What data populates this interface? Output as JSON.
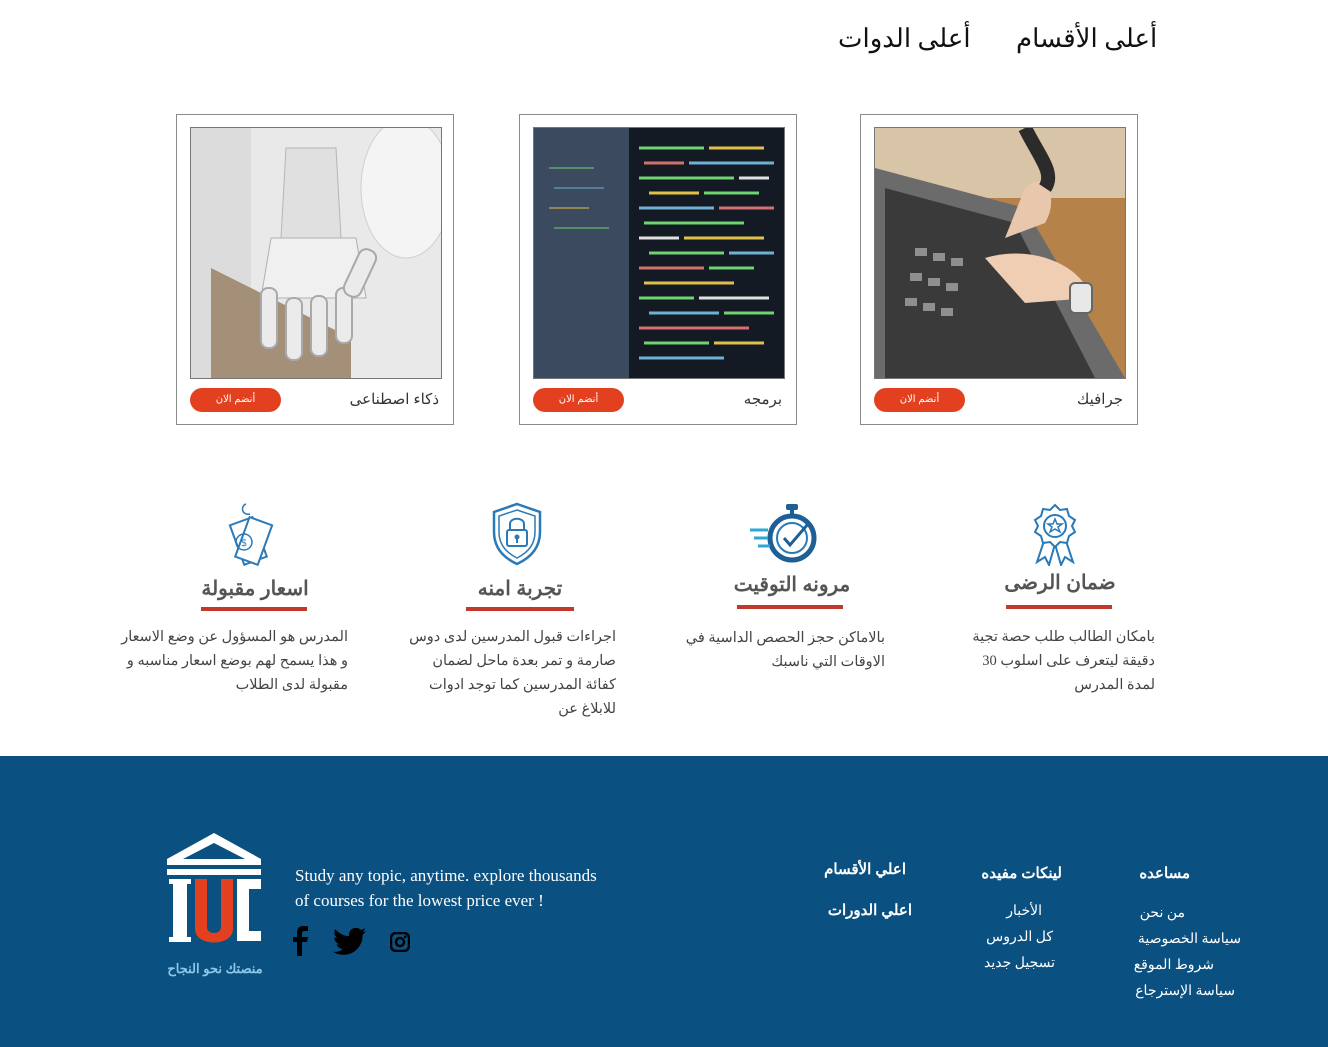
{
  "tabs": {
    "top_sections": "أعلى الأقسام",
    "top_courses": "أعلى الدوات"
  },
  "cards": [
    {
      "title": "جرافيك",
      "join_label": "أنضم الان"
    },
    {
      "title": "برمجه",
      "join_label": "أنضم الان"
    },
    {
      "title": "ذكاء اصطناعى",
      "join_label": "أنضم الان"
    }
  ],
  "features": [
    {
      "title": "ضمان الرضى",
      "text": "بامكان الطالب طلب حصة تجية دقيقة ليتعرف على اسلوب 30 لمدة المدرس",
      "icon": "award-badge-icon"
    },
    {
      "title": "مرونه التوقيت",
      "text": "بالاماكن حجز الحصص الداسية في الاوقات التي ناسبك",
      "icon": "stopwatch-icon"
    },
    {
      "title": "تجربة امنه",
      "text": "اجراءات قبول المدرسين لدى دوس صارمة و تمر بعدة ماحل لضمان كفائة المدرسين كما توجد ادوات للابلاغ عن",
      "icon": "shield-lock-icon"
    },
    {
      "title": "اسعار مقبولة",
      "text": "المدرس هو المسؤول عن وضع الاسعار و هذا يسمح لهم بوضع اسعار مناسبه و مقبولة لدى الطلاب",
      "icon": "price-tag-icon"
    }
  ],
  "footer": {
    "help": {
      "heading": "مساعده",
      "links": [
        "من نحن",
        "سياسة الخصوصية",
        "شروط الموقع",
        "سياسة الإسترجاع"
      ]
    },
    "useful": {
      "heading": "لينكات مفيده",
      "links": [
        "الأخبار",
        "كل الدروس",
        "تسجيل جديد"
      ]
    },
    "top_sections": "اعلي الأقسام",
    "top_courses": "اعلي الدورات",
    "tagline_line1": "Study any topic, anytime. explore thousands",
    "tagline_line2": "of courses for the lowest price ever !",
    "logo_caption": "منصتك نحو النجاح",
    "social_icons": [
      "facebook-icon",
      "twitter-icon",
      "instagram-icon"
    ]
  },
  "colors": {
    "accent": "#e2401e",
    "footer_bg": "#0a5080",
    "icon_blue": "#2a7ab8",
    "bar_red": "#c0392b"
  }
}
